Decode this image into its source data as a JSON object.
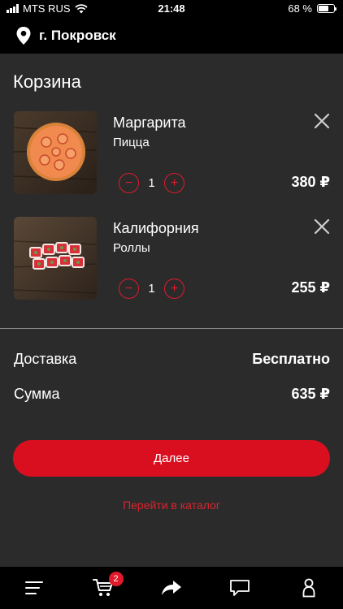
{
  "status_bar": {
    "carrier": "MTS RUS",
    "time": "21:48",
    "battery": "68 %",
    "battery_level": 0.68
  },
  "location": {
    "city": "г. Покровск",
    "icon": "location-pin-icon"
  },
  "page": {
    "title": "Корзина"
  },
  "cart": {
    "items": [
      {
        "name": "Маргарита",
        "category": "Пицца",
        "quantity": "1",
        "price": "380 ₽",
        "image": "pizza-image"
      },
      {
        "name": "Калифорния",
        "category": "Роллы",
        "quantity": "1",
        "price": "255 ₽",
        "image": "rolls-image"
      }
    ],
    "decrement_symbol": "−",
    "increment_symbol": "+"
  },
  "summary": {
    "delivery_label": "Доставка",
    "delivery_value": "Бесплатно",
    "total_label": "Сумма",
    "total_value": "635 ₽"
  },
  "actions": {
    "next_label": "Далее",
    "catalog_link": "Перейти в каталог"
  },
  "tab_bar": {
    "cart_badge": "2",
    "icons": [
      "menu-icon",
      "cart-icon",
      "share-icon",
      "chat-icon",
      "profile-icon"
    ]
  },
  "colors": {
    "accent": "#d90f1f",
    "background": "#2b2b2b",
    "bars": "#000000"
  }
}
